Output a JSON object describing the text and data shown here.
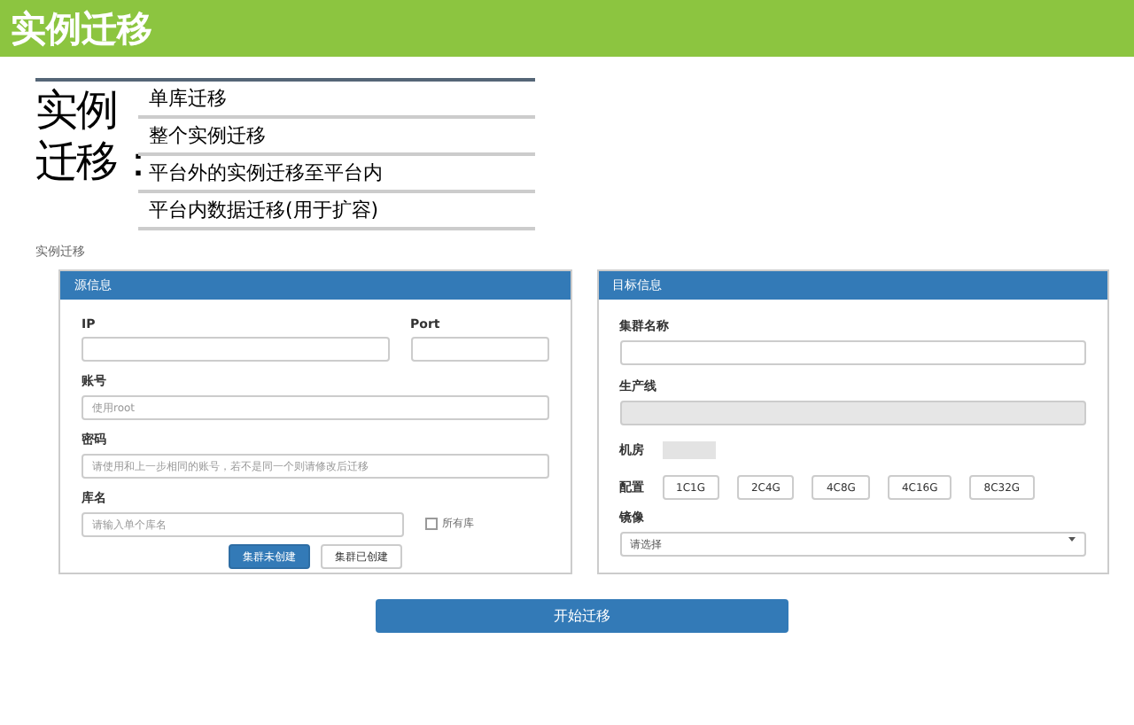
{
  "slide_title": "实例迁移",
  "topic": {
    "heading_lines": [
      "实例",
      "迁移："
    ],
    "items": [
      "单库迁移",
      "整个实例迁移",
      "平台外的实例迁移至平台内",
      "平台内数据迁移(用于扩容)"
    ]
  },
  "caption": "实例迁移",
  "source_panel": {
    "title": "源信息",
    "ip_label": "IP",
    "port_label": "Port",
    "account_label": "账号",
    "account_placeholder": "使用root",
    "password_label": "密码",
    "password_placeholder": "请使用和上一步相同的账号，若不是同一个则请修改后迁移",
    "db_label": "库名",
    "db_placeholder": "请输入单个库名",
    "all_db": {
      "label": "所有库",
      "checked": false
    },
    "buttons": [
      {
        "label": "集群未创建",
        "kind": "primary"
      },
      {
        "label": "集群已创建",
        "kind": "default"
      }
    ]
  },
  "target_panel": {
    "title": "目标信息",
    "cluster_label": "集群名称",
    "product_label": "生产线",
    "room_label": "机房",
    "config_label": "配置",
    "configs": [
      "1C1G",
      "2C4G",
      "4C8G",
      "4C16G",
      "8C32G"
    ],
    "image_label": "镜像",
    "image_select": "请选择"
  },
  "start_button": "开始迁移"
}
